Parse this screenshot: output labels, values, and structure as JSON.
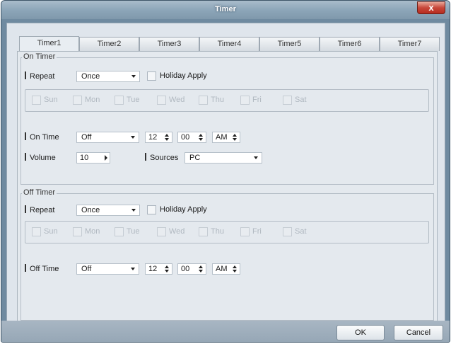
{
  "window": {
    "title": "Timer",
    "close_glyph": "x"
  },
  "tabs": [
    "Timer1",
    "Timer2",
    "Timer3",
    "Timer4",
    "Timer5",
    "Timer6",
    "Timer7"
  ],
  "on_timer": {
    "group_label": "On Timer",
    "repeat_label": "Repeat",
    "repeat_value": "Once",
    "holiday_label": "Holiday Apply",
    "days": [
      "Sun",
      "Mon",
      "Tue",
      "Wed",
      "Thu",
      "Fri",
      "Sat"
    ],
    "time_label": "On Time",
    "time_mode": "Off",
    "hour": "12",
    "minute": "00",
    "ampm": "AM",
    "volume_label": "Volume",
    "volume_value": "10",
    "sources_label": "Sources",
    "sources_value": "PC"
  },
  "off_timer": {
    "group_label": "Off Timer",
    "repeat_label": "Repeat",
    "repeat_value": "Once",
    "holiday_label": "Holiday Apply",
    "days": [
      "Sun",
      "Mon",
      "Tue",
      "Wed",
      "Thu",
      "Fri",
      "Sat"
    ],
    "time_label": "Off Time",
    "time_mode": "Off",
    "hour": "12",
    "minute": "00",
    "ampm": "AM"
  },
  "buttons": {
    "ok": "OK",
    "cancel": "Cancel"
  }
}
